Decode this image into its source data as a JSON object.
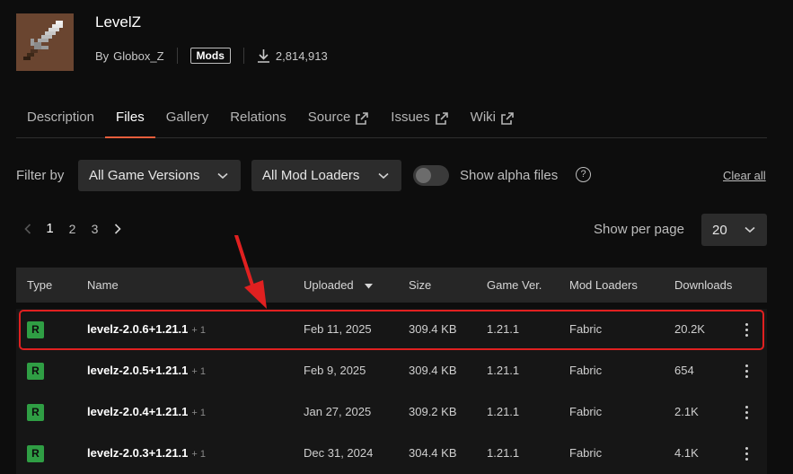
{
  "project": {
    "title": "LevelZ",
    "by_label": "By",
    "author": "Globox_Z",
    "category_badge": "Mods",
    "downloads": "2,814,913"
  },
  "tabs": [
    {
      "label": "Description",
      "active": false,
      "external": false
    },
    {
      "label": "Files",
      "active": true,
      "external": false
    },
    {
      "label": "Gallery",
      "active": false,
      "external": false
    },
    {
      "label": "Relations",
      "active": false,
      "external": false
    },
    {
      "label": "Source",
      "active": false,
      "external": true
    },
    {
      "label": "Issues",
      "active": false,
      "external": true
    },
    {
      "label": "Wiki",
      "active": false,
      "external": true
    }
  ],
  "filters": {
    "label": "Filter by",
    "game_versions": "All Game Versions",
    "mod_loaders": "All Mod Loaders",
    "alpha_label": "Show alpha files",
    "clear_all": "Clear all"
  },
  "pagination": {
    "pages": [
      "1",
      "2",
      "3"
    ],
    "current": "1",
    "per_page_label": "Show per page",
    "per_page_value": "20"
  },
  "table": {
    "headers": {
      "type": "Type",
      "name": "Name",
      "uploaded": "Uploaded",
      "size": "Size",
      "game_ver": "Game Ver.",
      "mod_loaders": "Mod Loaders",
      "downloads": "Downloads"
    },
    "rows": [
      {
        "type": "R",
        "name": "levelz-2.0.6+1.21.1",
        "extra": "+ 1",
        "uploaded": "Feb 11, 2025",
        "size": "309.4 KB",
        "game_ver": "1.21.1",
        "loader": "Fabric",
        "downloads": "20.2K"
      },
      {
        "type": "R",
        "name": "levelz-2.0.5+1.21.1",
        "extra": "+ 1",
        "uploaded": "Feb 9, 2025",
        "size": "309.4 KB",
        "game_ver": "1.21.1",
        "loader": "Fabric",
        "downloads": "654"
      },
      {
        "type": "R",
        "name": "levelz-2.0.4+1.21.1",
        "extra": "+ 1",
        "uploaded": "Jan 27, 2025",
        "size": "309.2 KB",
        "game_ver": "1.21.1",
        "loader": "Fabric",
        "downloads": "2.1K"
      },
      {
        "type": "R",
        "name": "levelz-2.0.3+1.21.1",
        "extra": "+ 1",
        "uploaded": "Dec 31, 2024",
        "size": "304.4 KB",
        "game_ver": "1.21.1",
        "loader": "Fabric",
        "downloads": "4.1K"
      }
    ]
  },
  "colors": {
    "accent": "#e85e3c",
    "release_badge": "#2f9e44",
    "highlight": "#e02020"
  }
}
